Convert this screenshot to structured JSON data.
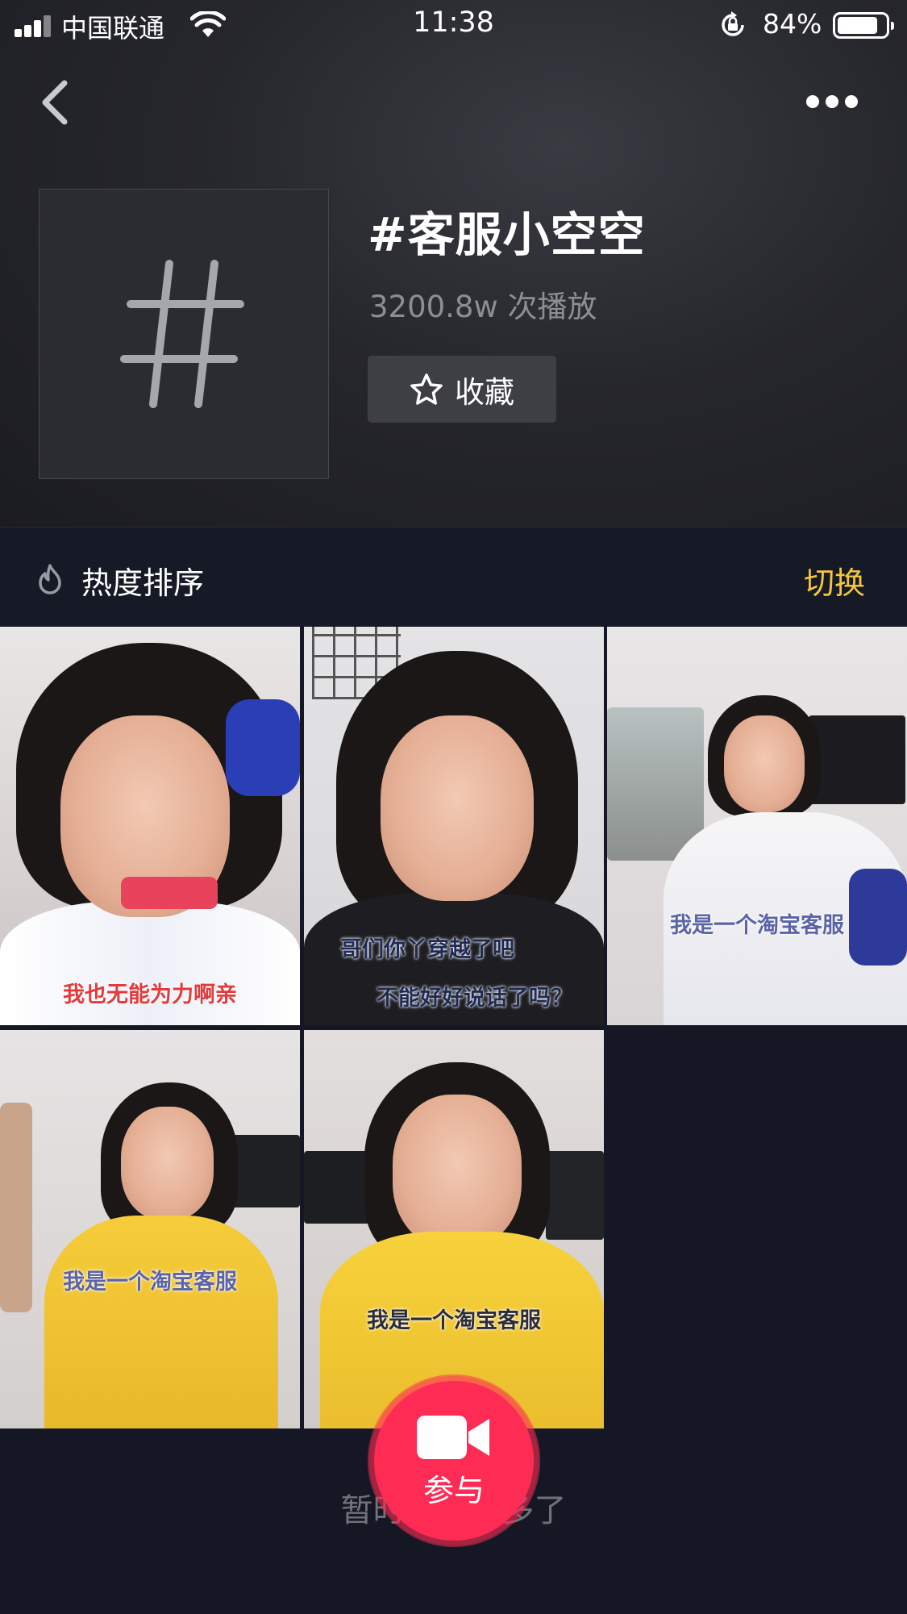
{
  "status_bar": {
    "carrier": "中国联通",
    "time": "11:38",
    "battery_percent": "84%",
    "battery_level": 0.84
  },
  "hashtag": {
    "title": "#客服小空空",
    "plays": "3200.8w 次播放",
    "favorite_label": "收藏"
  },
  "sort": {
    "label": "热度排序",
    "switch_label": "切换"
  },
  "videos": [
    {
      "caption": "我也无能为力啊亲",
      "caption_color": "#e23b3b"
    },
    {
      "caption": "哥们你丫穿越了吧",
      "caption2": "不能好好说话了吗？",
      "caption_color": "#1e2a55"
    },
    {
      "caption": "我是一个淘宝客服",
      "caption_color": "#5b64a8"
    },
    {
      "caption": "我是一个淘宝客服",
      "caption_color": "#5b64a8"
    },
    {
      "caption": "我是一个淘宝客服",
      "caption_color": "#2c2c3a"
    }
  ],
  "footer": {
    "empty_text": "暂时没有更多了",
    "join_label": "参与"
  },
  "colors": {
    "accent_pink": "#fe2c55",
    "accent_yellow": "#f4c63d",
    "background": "#151824"
  }
}
